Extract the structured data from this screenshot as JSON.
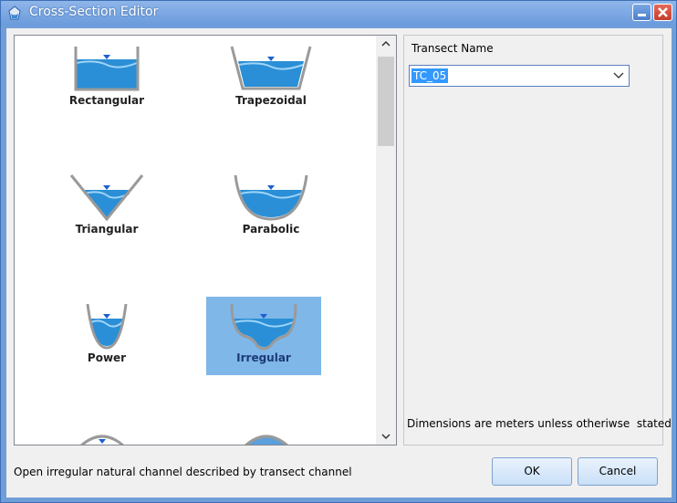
{
  "window": {
    "title": "Cross-Section Editor"
  },
  "shapes": [
    {
      "label": "Rectangular",
      "icon": "rectangular-channel-icon",
      "selected": false
    },
    {
      "label": "Trapezoidal",
      "icon": "trapezoidal-channel-icon",
      "selected": false
    },
    {
      "label": "Triangular",
      "icon": "triangular-channel-icon",
      "selected": false
    },
    {
      "label": "Parabolic",
      "icon": "parabolic-channel-icon",
      "selected": false
    },
    {
      "label": "Power",
      "icon": "power-channel-icon",
      "selected": false
    },
    {
      "label": "Irregular",
      "icon": "irregular-channel-icon",
      "selected": true
    }
  ],
  "transect": {
    "label": "Transect Name",
    "value": "TC_05"
  },
  "dimensions_note": "Dimensions are meters unless otheriwse  stated",
  "description": "Open irregular natural channel described by transect channel",
  "buttons": {
    "ok": "OK",
    "cancel": "Cancel"
  },
  "colors": {
    "selection": "#7fb7e8",
    "water": "#2a8fd6",
    "accent": "#3399ff"
  }
}
